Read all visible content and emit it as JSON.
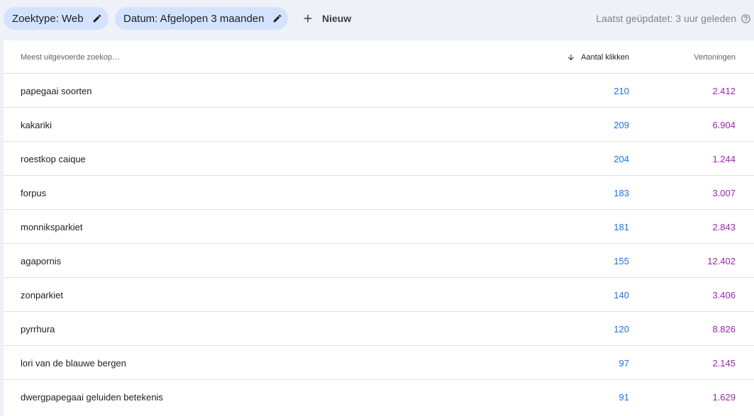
{
  "filters": {
    "search_type": "Zoektype: Web",
    "date": "Datum: Afgelopen 3 maanden",
    "new_label": "Nieuw",
    "last_updated": "Laatst geüpdatet: 3 uur geleden"
  },
  "colors": {
    "chip_bg": "#d3e3fd",
    "clicks": "#1a73e8",
    "impressions": "#9c27b0",
    "page_bg": "#eef1f7"
  },
  "icons": {
    "chip_edit": "pencil-icon",
    "new": "plus-icon",
    "sort": "arrow-down-icon",
    "help": "help-circle-icon"
  },
  "table": {
    "columns": {
      "query": "Meest uitgevoerde zoekop…",
      "clicks": "Aantal klikken",
      "impressions": "Vertoningen"
    },
    "sort": {
      "column": "clicks",
      "direction": "descending"
    },
    "rows": [
      {
        "query": "papegaai soorten",
        "clicks": "210",
        "impressions": "2.412"
      },
      {
        "query": "kakariki",
        "clicks": "209",
        "impressions": "6.904"
      },
      {
        "query": "roestkop caique",
        "clicks": "204",
        "impressions": "1.244"
      },
      {
        "query": "forpus",
        "clicks": "183",
        "impressions": "3.007"
      },
      {
        "query": "monniksparkiet",
        "clicks": "181",
        "impressions": "2.843"
      },
      {
        "query": "agapornis",
        "clicks": "155",
        "impressions": "12.402"
      },
      {
        "query": "zonparkiet",
        "clicks": "140",
        "impressions": "3.406"
      },
      {
        "query": "pyrrhura",
        "clicks": "120",
        "impressions": "8.826"
      },
      {
        "query": "lori van de blauwe bergen",
        "clicks": "97",
        "impressions": "2.145"
      },
      {
        "query": "dwergpapegaai geluiden betekenis",
        "clicks": "91",
        "impressions": "1.629"
      }
    ]
  }
}
